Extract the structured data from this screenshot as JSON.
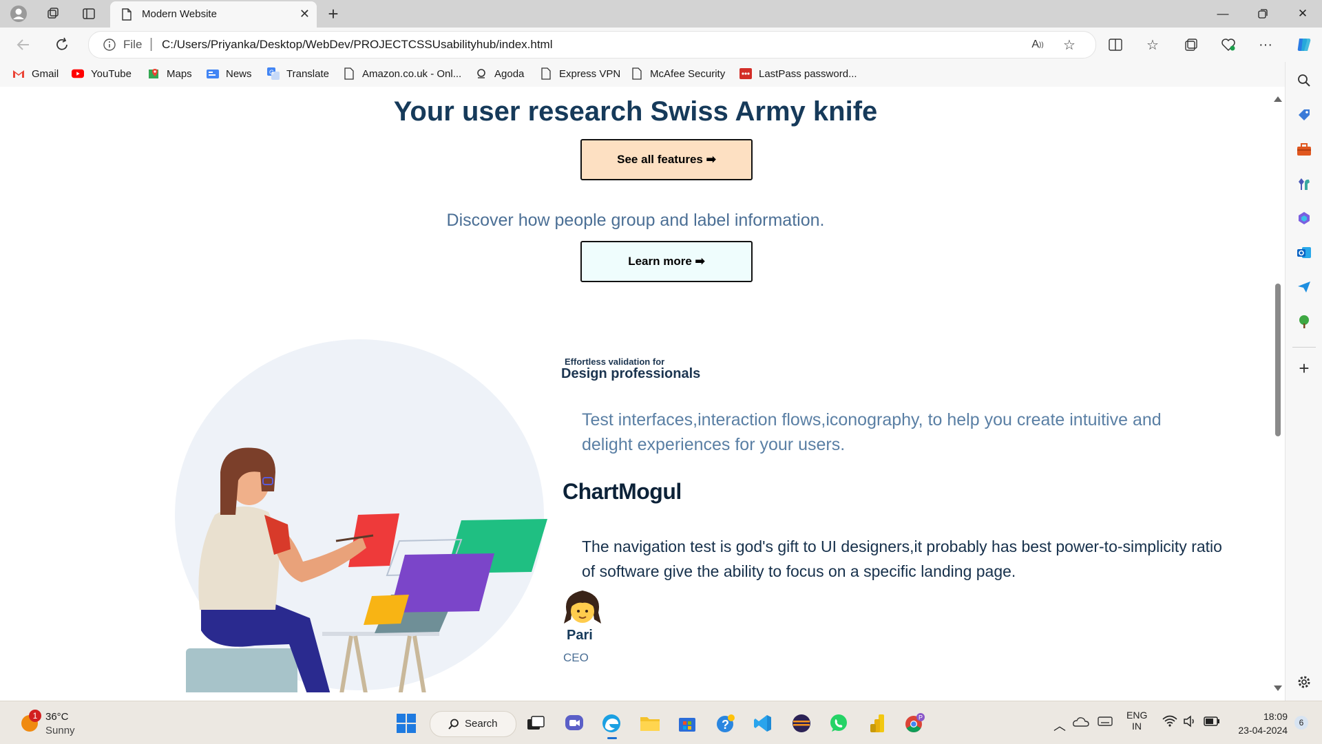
{
  "browser": {
    "tab_title": "Modern Website",
    "address_scheme": "File",
    "url": "C:/Users/Priyanka/Desktop/WebDev/PROJECTCSSUsabilityhub/index.html"
  },
  "bookmarks": [
    {
      "label": "Gmail",
      "icon": "gmail-icon"
    },
    {
      "label": "YouTube",
      "icon": "youtube-icon"
    },
    {
      "label": "Maps",
      "icon": "maps-icon"
    },
    {
      "label": "News",
      "icon": "news-icon"
    },
    {
      "label": "Translate",
      "icon": "translate-icon"
    },
    {
      "label": "Amazon.co.uk - Onl...",
      "icon": "page-icon"
    },
    {
      "label": "Agoda",
      "icon": "agoda-icon"
    },
    {
      "label": "Express VPN",
      "icon": "page-icon"
    },
    {
      "label": "McAfee Security",
      "icon": "page-icon"
    },
    {
      "label": "LastPass password...",
      "icon": "lastpass-icon"
    }
  ],
  "page": {
    "hero_title": "Your user research Swiss Army knife",
    "features_button": "See all features ➡",
    "discover_text": "Discover how people group and label information.",
    "learn_button": "Learn more ➡",
    "eyebrow": "Effortless validation for",
    "headline": "Design professionals",
    "description": "Test interfaces,interaction flows,iconography, to help you create intuitive and delight experiences for your users.",
    "brand": "ChartMogul",
    "quote": "The navigation test is god's gift to UI designers,it probably has best power-to-simplicity ratio of software give the ability to focus on a specific landing page.",
    "person_name": "Pari",
    "person_role": "CEO"
  },
  "taskbar": {
    "weather_temp": "36°C",
    "weather_text": "Sunny",
    "weather_badge": "1",
    "search_label": "Search",
    "lang_top": "ENG",
    "lang_bottom": "IN",
    "time": "18:09",
    "date": "23-04-2024",
    "notification_count": "6",
    "profile_badge": "P"
  },
  "colors": {
    "title_navy": "#163a5a",
    "features_button_bg": "#fde0c2",
    "learn_button_bg": "#effdfd",
    "muted_blue": "#4b6f95"
  }
}
